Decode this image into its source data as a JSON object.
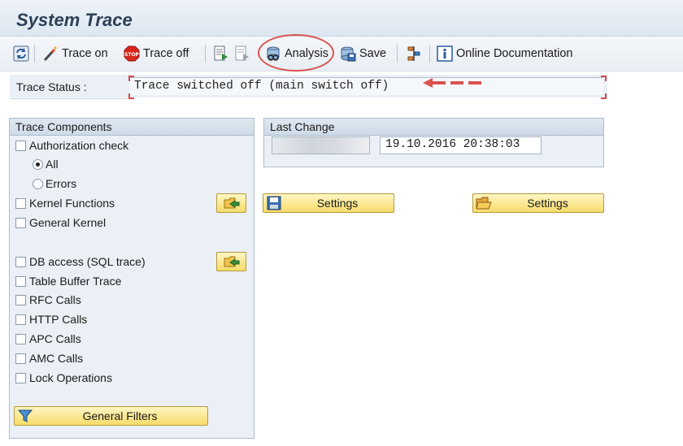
{
  "title": "System Trace",
  "toolbar": {
    "trace_on": "Trace on",
    "trace_off": "Trace off",
    "analysis": "Analysis",
    "save": "Save",
    "online_doc": "Online Documentation"
  },
  "status": {
    "label": "Trace Status :",
    "value": "Trace switched off (main switch off)"
  },
  "trace_components": {
    "header": "Trace Components",
    "authorization_check": "Authorization check",
    "radio_all": "All",
    "radio_errors": "Errors",
    "selected_radio": "All",
    "kernel_functions": "Kernel Functions",
    "general_kernel": "General Kernel",
    "db_access": "DB access (SQL trace)",
    "table_buffer": "Table Buffer Trace",
    "rfc_calls": "RFC Calls",
    "http_calls": "HTTP Calls",
    "apc_calls": "APC Calls",
    "amc_calls": "AMC Calls",
    "lock_operations": "Lock Operations",
    "general_filters": "General Filters"
  },
  "last_change": {
    "header": "Last Change",
    "user": "",
    "datetime": "19.10.2016 20:38:03"
  },
  "settings": {
    "left": "Settings",
    "right": "Settings"
  },
  "colors": {
    "highlight_ring": "#d9534f",
    "button_yellow": "#f6dc6a",
    "panel_bg": "#eaf0f6"
  }
}
